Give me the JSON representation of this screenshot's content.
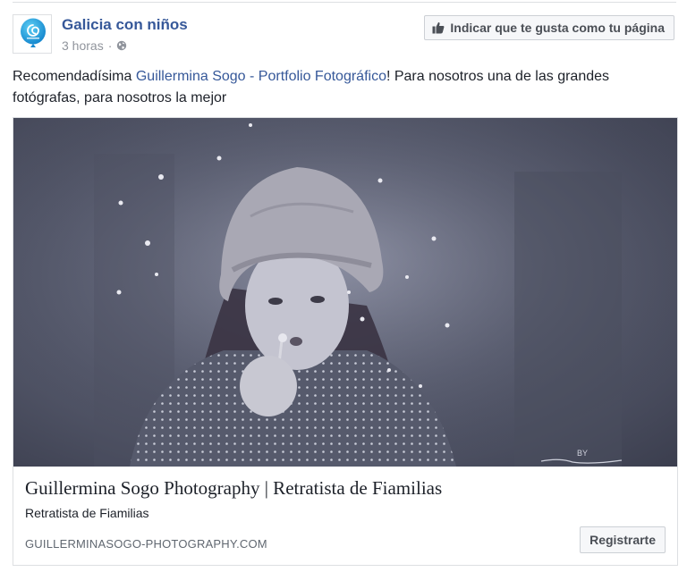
{
  "post": {
    "page_name": "Galicia con niños",
    "time": "3 horas",
    "separator": "·",
    "privacy_icon": "globe-icon",
    "like_page_button": "Indicar que te gusta como tu página",
    "text_before": "Recomendadísima ",
    "linked_page": "Guillermina Sogo - Portfolio Fotográfico",
    "text_after": "! Para nosotros una de las grandes fotógrafas, para nosotros la mejor"
  },
  "link_card": {
    "image_icon": "photo-girl-blowing-dandelion",
    "title": "Guillermina Sogo Photography | Retratista de Fiamilias",
    "description": "Retratista de Fiamilias",
    "domain": "GUILLERMINASOGO-PHOTOGRAPHY.COM",
    "cta_button": "Registrarte"
  },
  "colors": {
    "link": "#365899",
    "secondary_text": "#90949c",
    "button_bg": "#f6f7f9",
    "border": "#dddfe2"
  }
}
